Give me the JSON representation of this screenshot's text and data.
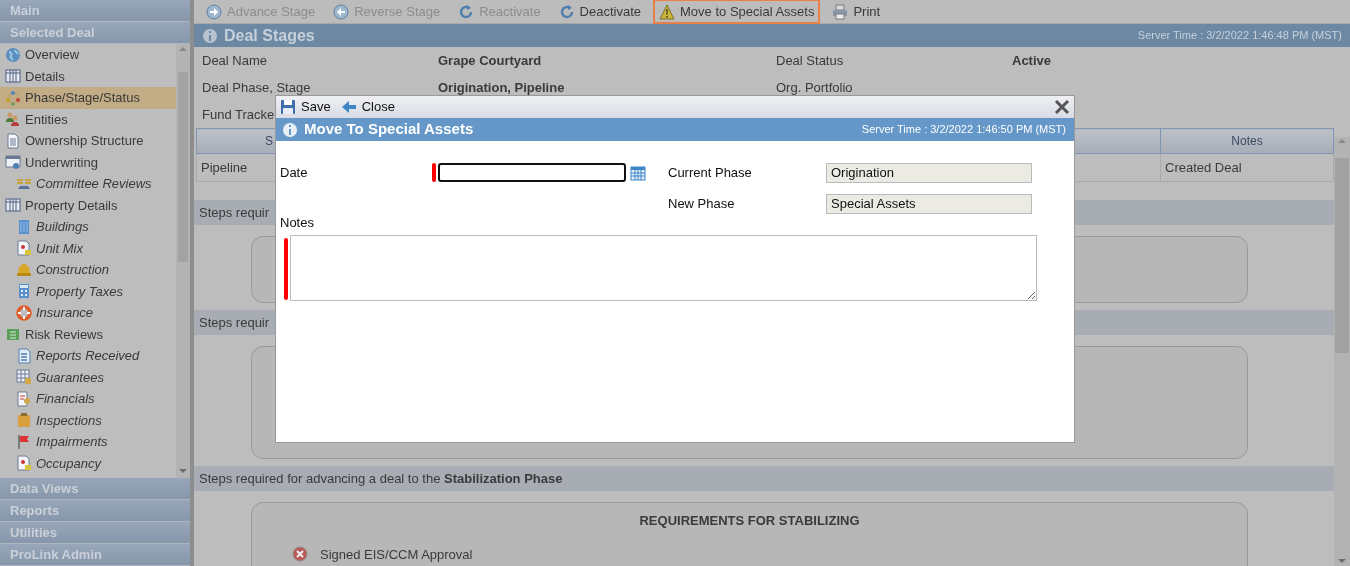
{
  "toolbar": [
    {
      "label": "Advance Stage",
      "disabled": true,
      "highlighted": false
    },
    {
      "label": "Reverse Stage",
      "disabled": true,
      "highlighted": false
    },
    {
      "label": "Reactivate",
      "disabled": true,
      "highlighted": false
    },
    {
      "label": "Deactivate",
      "disabled": false,
      "highlighted": false
    },
    {
      "label": "Move to Special Assets",
      "disabled": false,
      "highlighted": true
    },
    {
      "label": "Print",
      "disabled": false,
      "highlighted": false
    }
  ],
  "sidebar": {
    "top_sections": [
      "Main",
      "Selected Deal"
    ],
    "items": [
      {
        "label": "Overview",
        "selected": false
      },
      {
        "label": "Details",
        "selected": false
      },
      {
        "label": "Phase/Stage/Status",
        "selected": true
      },
      {
        "label": "Entities",
        "selected": false
      },
      {
        "label": "Ownership Structure",
        "selected": false
      },
      {
        "label": "Underwriting",
        "selected": false,
        "children": [
          {
            "label": "Committee Reviews",
            "selected": false
          }
        ]
      },
      {
        "label": "Property Details",
        "selected": false,
        "children": [
          {
            "label": "Buildings",
            "selected": false
          },
          {
            "label": "Unit Mix",
            "selected": false
          },
          {
            "label": "Construction",
            "selected": false
          },
          {
            "label": "Property Taxes",
            "selected": false
          },
          {
            "label": "Insurance",
            "selected": false
          }
        ]
      },
      {
        "label": "Risk Reviews",
        "selected": false,
        "children": [
          {
            "label": "Reports Received",
            "selected": false
          },
          {
            "label": "Guarantees",
            "selected": false
          },
          {
            "label": "Financials",
            "selected": false
          },
          {
            "label": "Inspections",
            "selected": false
          },
          {
            "label": "Impairments",
            "selected": false
          },
          {
            "label": "Occupancy",
            "selected": false
          }
        ]
      }
    ],
    "bottom_sections": [
      "Data Views",
      "Reports",
      "Utilities",
      "ProLink Admin"
    ]
  },
  "panel": {
    "title": "Deal Stages",
    "server_time": "Server Time : 3/2/2022 1:46:48 PM (MST)",
    "fields": [
      {
        "label": "Deal Name",
        "value": "Grape Courtyard",
        "label_2": "Deal Status",
        "value_2": "Active"
      },
      {
        "label": "Deal Phase, Stage",
        "value": "Origination, Pipeline",
        "label_2": "Org. Portfolio"
      },
      {
        "label": "Fund Tracke"
      }
    ],
    "table": {
      "columns": [
        "S",
        "Notes"
      ],
      "rows": [
        [
          "Pipeline",
          "Created Deal"
        ]
      ]
    },
    "steps": [
      {
        "text": "Steps requir"
      },
      {
        "text": "Steps requir"
      },
      {
        "text": "Steps required for advancing a deal to the **Stabilization Phase**",
        "requirements_title": "REQUIREMENTS FOR STABILIZING",
        "requirements": [
          {
            "label": "Signed EIS/CCM Approval",
            "met": false
          }
        ]
      }
    ]
  },
  "dialog": {
    "toolbar": [
      "Save",
      "Close"
    ],
    "title": "Move To Special Assets",
    "server_time": "Server Time : 3/2/2022 1:46:50 PM (MST)",
    "date": {
      "label": "Date",
      "required": true
    },
    "current_phase": {
      "label": "Current Phase",
      "value": "Origination"
    },
    "new_phase": {
      "label": "New Phase",
      "value": "Special Assets"
    },
    "notes": {
      "label": "Notes",
      "required": true
    }
  }
}
